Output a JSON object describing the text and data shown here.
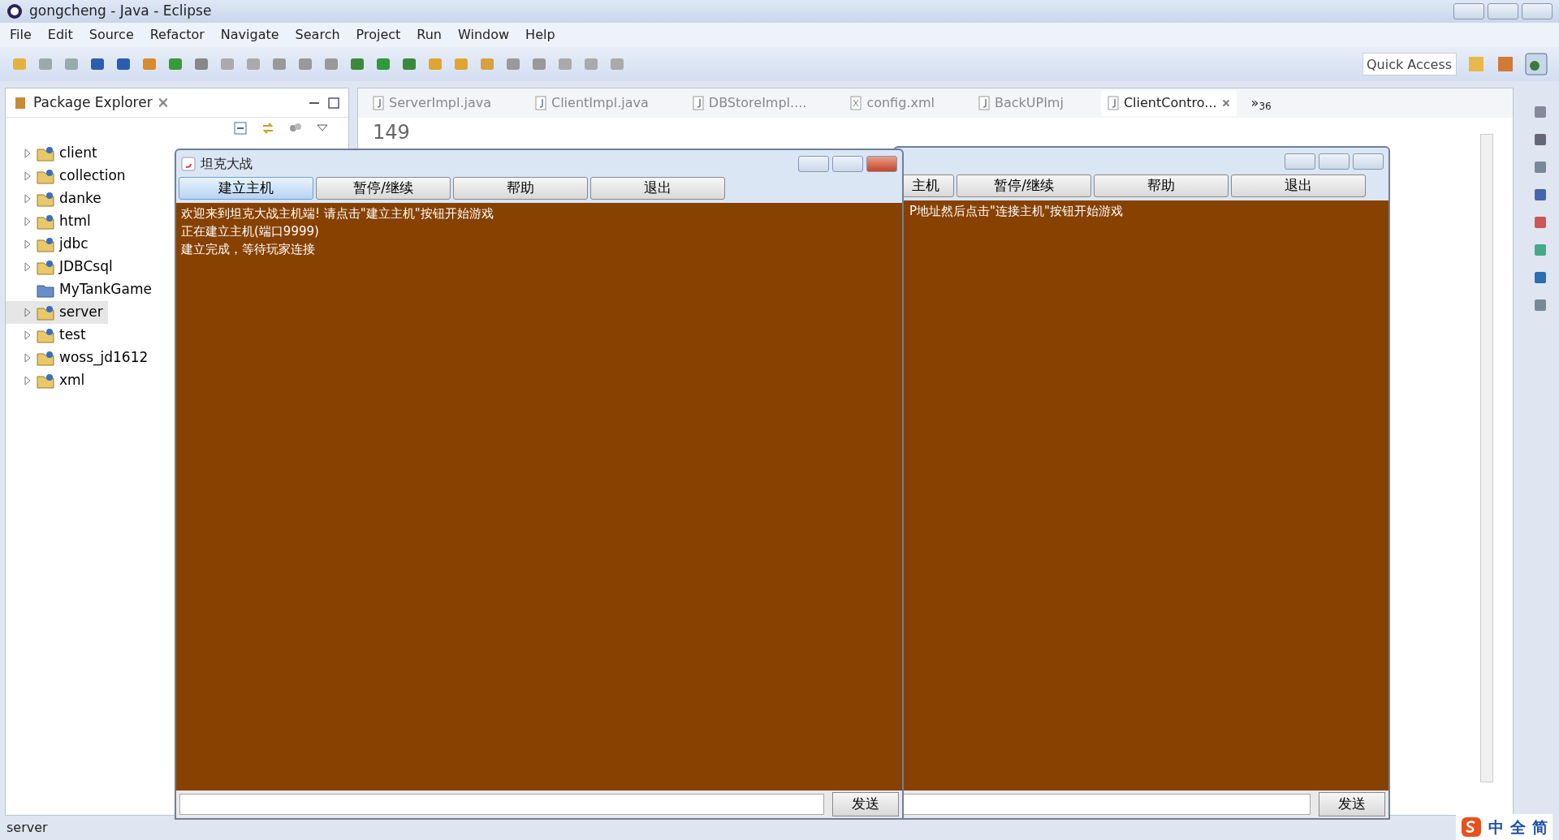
{
  "window": {
    "title": "gongcheng - Java - Eclipse"
  },
  "menu": [
    "File",
    "Edit",
    "Source",
    "Refactor",
    "Navigate",
    "Search",
    "Project",
    "Run",
    "Window",
    "Help"
  ],
  "quick_access": {
    "placeholder": "Quick Access"
  },
  "package_explorer": {
    "title": "Package Explorer",
    "items": [
      {
        "label": "client",
        "expandable": true,
        "selected": false
      },
      {
        "label": "collection",
        "expandable": true,
        "selected": false
      },
      {
        "label": "danke",
        "expandable": true,
        "selected": false
      },
      {
        "label": "html",
        "expandable": true,
        "selected": false
      },
      {
        "label": "jdbc",
        "expandable": true,
        "selected": false
      },
      {
        "label": "JDBCsql",
        "expandable": true,
        "selected": false
      },
      {
        "label": "MyTankGame",
        "expandable": false,
        "selected": false
      },
      {
        "label": "server",
        "expandable": true,
        "selected": true
      },
      {
        "label": "test",
        "expandable": true,
        "selected": false
      },
      {
        "label": "woss_jd1612",
        "expandable": true,
        "selected": false
      },
      {
        "label": "xml",
        "expandable": true,
        "selected": false
      }
    ]
  },
  "editor": {
    "tabs": [
      {
        "label": "ServerImpl.java",
        "kind": "java",
        "selected": false
      },
      {
        "label": "ClientImpl.java",
        "kind": "java",
        "selected": false
      },
      {
        "label": "DBStoreImpl....",
        "kind": "java",
        "selected": false
      },
      {
        "label": "config.xml",
        "kind": "xml",
        "selected": false
      },
      {
        "label": "BackUPImj",
        "kind": "java",
        "selected": false
      },
      {
        "label": "ClientContro...",
        "kind": "java",
        "selected": true
      }
    ],
    "overflow": "»$_{36}$",
    "line_number": "149"
  },
  "game_windows": [
    {
      "title": "坦克大战",
      "buttons": [
        {
          "label": "建立主机",
          "selected": true
        },
        {
          "label": "暂停/继续",
          "selected": false
        },
        {
          "label": "帮助",
          "selected": false
        },
        {
          "label": "退出",
          "selected": false
        }
      ],
      "log": [
        "欢迎来到坦克大战主机端! 请点击\"建立主机\"按钮开始游戏",
        "正在建立主机(端口9999)",
        "建立完成，等待玩家连接"
      ],
      "send": "发送"
    },
    {
      "buttons": [
        {
          "label": "主机",
          "selected": false
        },
        {
          "label": "暂停/继续",
          "selected": false
        },
        {
          "label": "帮助",
          "selected": false
        },
        {
          "label": "退出",
          "selected": false
        }
      ],
      "log": [
        "P地址然后点击\"连接主机\"按钮开始游戏"
      ],
      "send": "发送"
    }
  ],
  "status_bar": {
    "text": "server"
  },
  "ime_bar": [
    "中",
    "全",
    "简"
  ]
}
